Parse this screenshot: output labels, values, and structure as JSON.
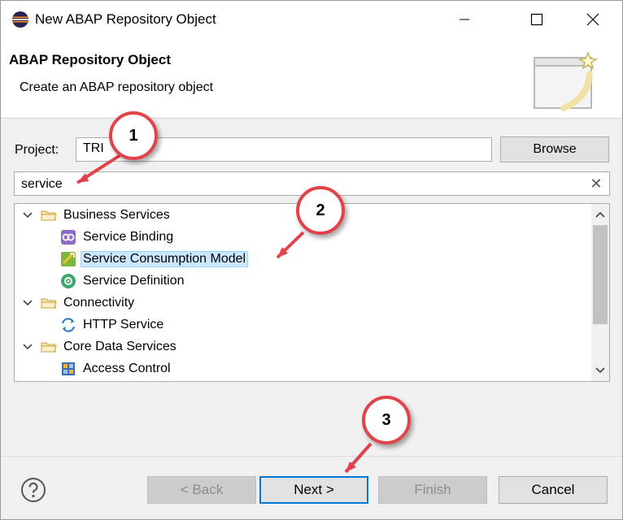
{
  "window": {
    "title": "New ABAP Repository Object",
    "icon": "eclipse-icon"
  },
  "banner": {
    "title": "ABAP Repository Object",
    "description": "Create an ABAP repository object"
  },
  "project": {
    "label": "Project:",
    "value": "TRI",
    "browse_label": "Browse"
  },
  "search": {
    "value": "service",
    "clear_glyph": "✕"
  },
  "tree": {
    "items": [
      {
        "label": "Business Services",
        "level": 0,
        "expanded": true,
        "icon": "folder-icon"
      },
      {
        "label": "Service Binding",
        "level": 1,
        "icon": "service-binding-icon"
      },
      {
        "label": "Service Consumption Model",
        "level": 1,
        "icon": "service-consumption-model-icon",
        "selected": true
      },
      {
        "label": "Service Definition",
        "level": 1,
        "icon": "service-definition-icon"
      },
      {
        "label": "Connectivity",
        "level": 0,
        "expanded": true,
        "icon": "folder-icon"
      },
      {
        "label": "HTTP Service",
        "level": 1,
        "icon": "http-service-icon"
      },
      {
        "label": "Core Data Services",
        "level": 0,
        "expanded": true,
        "icon": "folder-icon"
      },
      {
        "label": "Access Control",
        "level": 1,
        "icon": "access-control-icon"
      }
    ]
  },
  "footer": {
    "back_label": "< Back",
    "next_label": "Next >",
    "finish_label": "Finish",
    "cancel_label": "Cancel"
  },
  "callouts": [
    "1",
    "2",
    "3"
  ],
  "colors": {
    "callout_border": "#e2434a",
    "selection": "#cce8ff",
    "primary_border": "#0078d7"
  }
}
